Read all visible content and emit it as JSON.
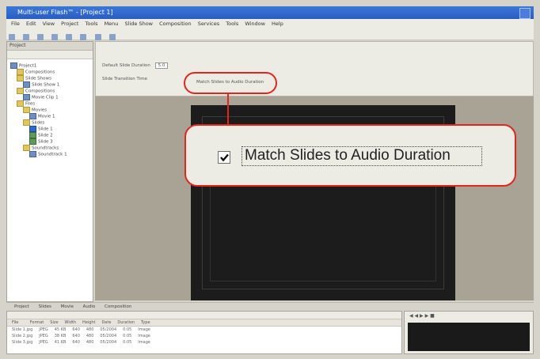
{
  "window": {
    "title": "Multi-user Flash™ - [Project 1]"
  },
  "menubar": [
    "File",
    "Edit",
    "View",
    "Project",
    "Tools",
    "Menu",
    "Slide Show",
    "Composition",
    "Services",
    "Tools",
    "Window",
    "Help"
  ],
  "left_pane": {
    "title": "Project",
    "tree": [
      "Project1",
      "Compositions",
      "Slide Shows",
      "Slide Show 1",
      "Compositions",
      "Movie Clip 1",
      "Files",
      "Movies",
      "Movie 1",
      "Slides",
      "Slide 1",
      "Slide 2",
      "Slide 3",
      "Soundtracks",
      "Soundtrack 1"
    ]
  },
  "editor": {
    "default_duration_label": "Default Slide Duration",
    "default_duration_value": "5.0",
    "transition_label": "Slide Transition Time",
    "mini_checkbox_label": "Match Slides to Audio Duration"
  },
  "callout": {
    "checkbox_checked": true,
    "label": "Match Slides to Audio Duration"
  },
  "tabs": [
    "Project",
    "Slides",
    "Movie",
    "Audio",
    "Composition"
  ],
  "bottom": {
    "columns": [
      "File",
      "Format",
      "Size",
      "Width",
      "Height",
      "Date",
      "Duration",
      "Type"
    ],
    "rows": [
      [
        "Slide 1.jpg",
        "JPEG",
        "45 KB",
        "640",
        "480",
        "05/2004",
        "0:05",
        "Image"
      ],
      [
        "Slide 2.jpg",
        "JPEG",
        "38 KB",
        "640",
        "480",
        "05/2004",
        "0:05",
        "Image"
      ],
      [
        "Slide 3.jpg",
        "JPEG",
        "41 KB",
        "640",
        "480",
        "05/2004",
        "0:05",
        "Image"
      ]
    ]
  },
  "preview": {
    "controls": "◀ ◀ ▶ ▶ ■"
  }
}
